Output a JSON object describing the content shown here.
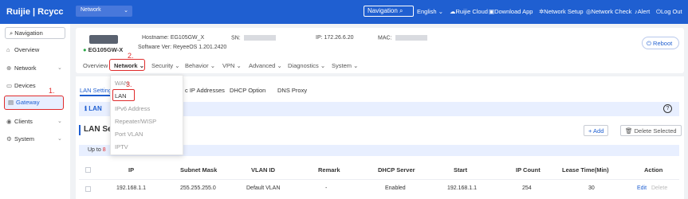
{
  "brand": {
    "logo": "Ruijie | Rcycc"
  },
  "topbar": {
    "project": "Network",
    "navigation": "Navigation",
    "language": "English",
    "links": [
      "Ruijie Cloud",
      "Download App",
      "Network Setup",
      "Network Check",
      "Alert",
      "Log Out"
    ]
  },
  "sidebar": {
    "navigation": "Navigation",
    "items": [
      "Overview",
      "Network",
      "Devices",
      "Gateway",
      "Clients",
      "System"
    ]
  },
  "annotations": [
    "1.",
    "2.",
    "3."
  ],
  "device": {
    "model": "EG105GW-X",
    "hostname_label": "Hostname:",
    "hostname": "EG105GW_X",
    "sn_label": "SN:",
    "software_label": "Software Ver:",
    "software": "ReyeeOS 1.201.2420",
    "ip_label": "IP:",
    "ip": "172.26.6.20",
    "mac_label": "MAC:",
    "reboot": "Reboot"
  },
  "tabs": [
    "Overview",
    "Network",
    "Security",
    "Behavior",
    "VPN",
    "Advanced",
    "Diagnostics",
    "System"
  ],
  "dropdown": [
    "WAN",
    "LAN",
    "IPv6 Address",
    "Repeater/WISP",
    "Port VLAN",
    "IPTV"
  ],
  "subtabs": [
    "LAN Settings",
    "c IP Addresses",
    "DHCP Option",
    "DNS Proxy"
  ],
  "lan": {
    "info": "LAN",
    "title": "LAN Set",
    "up_to": "Up to",
    "up_to_num": "8",
    "add": "+ Add",
    "delete_selected": "Delete Selected"
  },
  "table": {
    "headers": [
      "IP",
      "Subnet Mask",
      "VLAN ID",
      "Remark",
      "DHCP Server",
      "Start",
      "IP Count",
      "Lease Time(Min)",
      "Action"
    ],
    "row": [
      "192.168.1.1",
      "255.255.255.0",
      "Default VLAN",
      "-",
      "Enabled",
      "192.168.1.1",
      "254",
      "30"
    ],
    "edit": "Edit",
    "delete": "Delete"
  },
  "colors": {
    "primary": "#1f5fd1",
    "highlight": "#e02b2b"
  }
}
